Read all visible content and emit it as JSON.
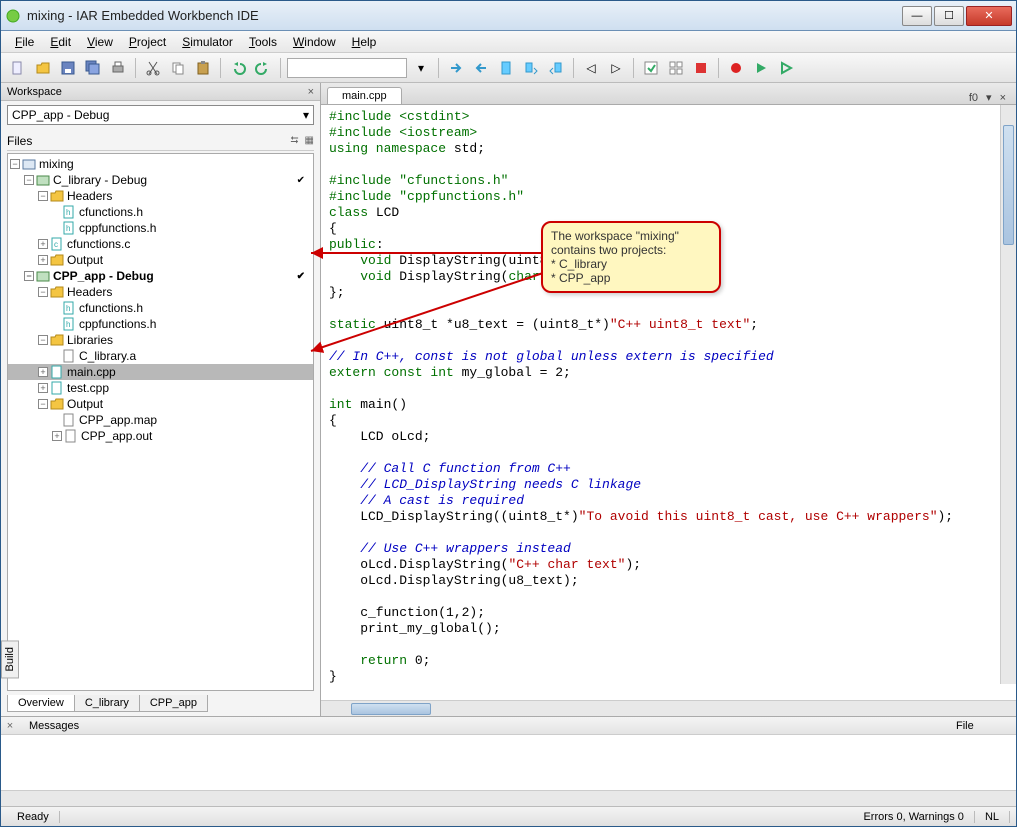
{
  "window": {
    "title": "mixing - IAR Embedded Workbench IDE"
  },
  "menu": {
    "items": [
      "File",
      "Edit",
      "View",
      "Project",
      "Simulator",
      "Tools",
      "Window",
      "Help"
    ]
  },
  "workspace": {
    "panel_title": "Workspace",
    "combo": "CPP_app - Debug",
    "files_label": "Files",
    "tree": {
      "root": "mixing",
      "p1": "C_library - Debug",
      "p1_headers": "Headers",
      "p1_h1": "cfunctions.h",
      "p1_h2": "cppfunctions.h",
      "p1_c1": "cfunctions.c",
      "p1_out": "Output",
      "p2": "CPP_app - Debug",
      "p2_headers": "Headers",
      "p2_h1": "cfunctions.h",
      "p2_h2": "cppfunctions.h",
      "p2_libs": "Libraries",
      "p2_lib1": "C_library.a",
      "p2_main": "main.cpp",
      "p2_test": "test.cpp",
      "p2_out": "Output",
      "p2_map": "CPP_app.map",
      "p2_outf": "CPP_app.out"
    },
    "tabs": [
      "Overview",
      "C_library",
      "CPP_app"
    ]
  },
  "editor": {
    "tab": "main.cpp",
    "fn_indicator": "f0",
    "code_lines": [
      {
        "t": "#include <cstdint>",
        "c": "kw"
      },
      {
        "t": "#include <iostream>",
        "c": "kw"
      },
      {
        "seg": [
          {
            "t": "using namespace",
            "c": "kw"
          },
          {
            "t": " std;",
            "c": ""
          }
        ]
      },
      {
        "t": "",
        "c": ""
      },
      {
        "t": "#include \"cfunctions.h\"",
        "c": "kw"
      },
      {
        "t": "#include \"cppfunctions.h\"",
        "c": "kw"
      },
      {
        "seg": [
          {
            "t": "class",
            "c": "kw"
          },
          {
            "t": " LCD",
            "c": ""
          }
        ]
      },
      {
        "t": "{",
        "c": ""
      },
      {
        "seg": [
          {
            "t": "public",
            "c": "kw"
          },
          {
            "t": ":",
            "c": ""
          }
        ]
      },
      {
        "seg": [
          {
            "t": "    ",
            "c": ""
          },
          {
            "t": "void",
            "c": "kw"
          },
          {
            "t": " DisplayString(uint8_t *text);",
            "c": ""
          }
        ]
      },
      {
        "seg": [
          {
            "t": "    ",
            "c": ""
          },
          {
            "t": "void",
            "c": "kw"
          },
          {
            "t": " DisplayString(",
            "c": ""
          },
          {
            "t": "char",
            "c": "kw"
          },
          {
            "t": " *text);",
            "c": ""
          }
        ]
      },
      {
        "t": "};",
        "c": ""
      },
      {
        "t": "",
        "c": ""
      },
      {
        "seg": [
          {
            "t": "static",
            "c": "kw"
          },
          {
            "t": " uint8_t *u8_text = (uint8_t*)",
            "c": ""
          },
          {
            "t": "\"C++ uint8_t text\"",
            "c": "str"
          },
          {
            "t": ";",
            "c": ""
          }
        ]
      },
      {
        "t": "",
        "c": ""
      },
      {
        "t": "// In C++, const is not global unless extern is specified",
        "c": "cm"
      },
      {
        "seg": [
          {
            "t": "extern const int",
            "c": "kw"
          },
          {
            "t": " my_global = 2;",
            "c": ""
          }
        ]
      },
      {
        "t": "",
        "c": ""
      },
      {
        "seg": [
          {
            "t": "int",
            "c": "kw"
          },
          {
            "t": " main()",
            "c": ""
          }
        ]
      },
      {
        "t": "{",
        "c": ""
      },
      {
        "t": "    LCD oLcd;",
        "c": ""
      },
      {
        "t": "",
        "c": ""
      },
      {
        "t": "    // Call C function from C++",
        "c": "cm"
      },
      {
        "t": "    // LCD_DisplayString needs C linkage",
        "c": "cm"
      },
      {
        "t": "    // A cast is required",
        "c": "cm"
      },
      {
        "seg": [
          {
            "t": "    LCD_DisplayString((uint8_t*)",
            "c": ""
          },
          {
            "t": "\"To avoid this uint8_t cast, use C++ wrappers\"",
            "c": "str"
          },
          {
            "t": ");",
            "c": ""
          }
        ]
      },
      {
        "t": "",
        "c": ""
      },
      {
        "t": "    // Use C++ wrappers instead",
        "c": "cm"
      },
      {
        "seg": [
          {
            "t": "    oLcd.DisplayString(",
            "c": ""
          },
          {
            "t": "\"C++ char text\"",
            "c": "str"
          },
          {
            "t": ");",
            "c": ""
          }
        ]
      },
      {
        "t": "    oLcd.DisplayString(u8_text);",
        "c": ""
      },
      {
        "t": "",
        "c": ""
      },
      {
        "t": "    c_function(1,2);",
        "c": ""
      },
      {
        "t": "    print_my_global();",
        "c": ""
      },
      {
        "t": "",
        "c": ""
      },
      {
        "seg": [
          {
            "t": "    ",
            "c": ""
          },
          {
            "t": "return",
            "c": "kw"
          },
          {
            "t": " 0;",
            "c": ""
          }
        ]
      },
      {
        "t": "}",
        "c": ""
      }
    ]
  },
  "annotation": {
    "l1": "The workspace \"mixing\"",
    "l2": "contains two projects:",
    "l3": "* C_library",
    "l4": "* CPP_app"
  },
  "build": {
    "vtab": "Build",
    "col_messages": "Messages",
    "col_file": "File"
  },
  "status": {
    "ready": "Ready",
    "errors": "Errors 0, Warnings 0",
    "nl": "NL"
  }
}
